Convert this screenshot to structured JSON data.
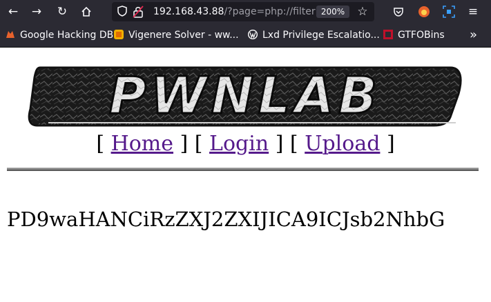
{
  "browser": {
    "url_host": "192.168.43.88",
    "url_rest": "/?page=php://filter",
    "zoom": "200%",
    "bookmarks": [
      {
        "label": "Google Hacking DB",
        "icon": "fox-icon",
        "color": "#e8622c"
      },
      {
        "label": "Vigenere Solver - ww...",
        "icon": "vigenere-icon",
        "color": "#f0b000"
      },
      {
        "label": "Lxd Privilege Escalatio...",
        "icon": "wordpress-icon",
        "color": "#ffffff"
      },
      {
        "label": "GTFOBins",
        "icon": "gtfobins-icon",
        "color": "#c0102a"
      }
    ]
  },
  "site": {
    "logo_text": "PWNLAB",
    "nav": [
      {
        "label": "Home"
      },
      {
        "label": "Login"
      },
      {
        "label": "Upload"
      }
    ],
    "encoded_output": "PD9waHANCiRzZXJ2ZXIJICA9ICJsb2NhbG"
  }
}
